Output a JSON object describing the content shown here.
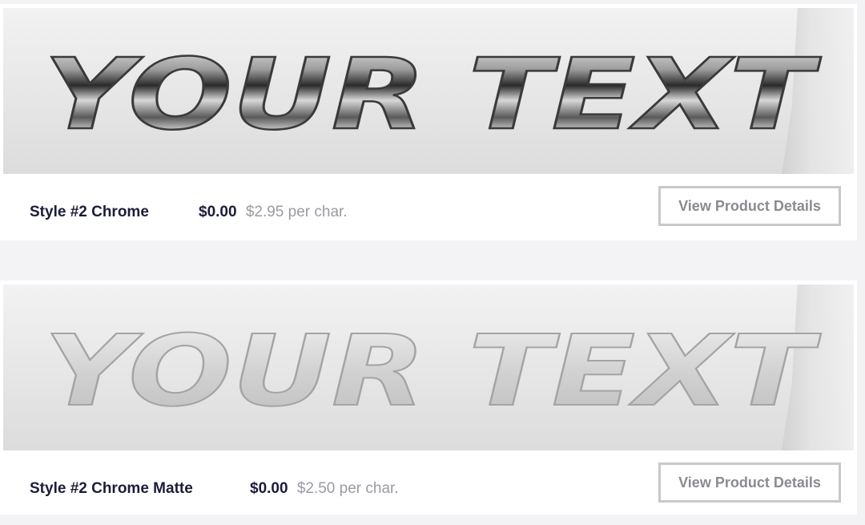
{
  "products": [
    {
      "banner_text": "YOUR TEXT",
      "name": "Style #2 Chrome",
      "price": "$0.00",
      "per_char": "$2.95 per char.",
      "details_label": "View Product Details",
      "finish": "chrome"
    },
    {
      "banner_text": "YOUR TEXT",
      "name": "Style #2 Chrome Matte",
      "price": "$0.00",
      "per_char": "$2.50 per char.",
      "details_label": "View Product Details",
      "finish": "matte"
    }
  ],
  "colors": {
    "page_bg": "#f3f3f5",
    "name_text": "#1c1c3a",
    "muted_text": "#9a9aa2",
    "button_border": "#c8c8cc"
  }
}
